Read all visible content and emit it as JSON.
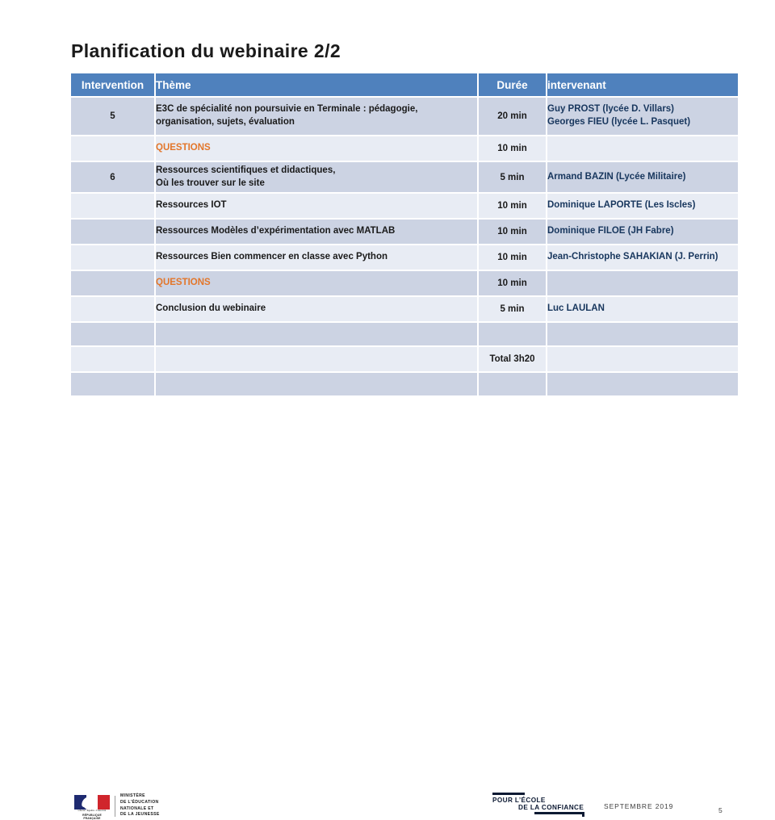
{
  "slide": {
    "title": "Planification du webinaire 2/2",
    "page_number": "5",
    "date": "SEPTEMBRE 2019"
  },
  "colors": {
    "header_blue": "#4f81bd",
    "band_dark": "#ccd3e3",
    "band_light": "#e8ecf4",
    "accent_orange": "#e3762a",
    "speaker_blue": "#17365d"
  },
  "table": {
    "headers": {
      "intervention": "Intervention",
      "theme": "Thème",
      "duree": "Durée",
      "intervenant": "intervenant"
    },
    "rows": [
      {
        "intervention": "5",
        "theme_line1": "E3C de spécialité non poursuivie en Terminale : pédagogie,",
        "theme_line2": "organisation, sujets, évaluation",
        "duree": "20 min",
        "speaker_line1": "Guy PROST (lycée D. Villars)",
        "speaker_line2": "Georges FIEU (lycée L. Pasquet)"
      },
      {
        "intervention": "",
        "theme_line1": "QUESTIONS",
        "theme_line2": "",
        "duree": "10 min",
        "speaker_line1": "",
        "speaker_line2": ""
      },
      {
        "intervention": "6",
        "theme_line1": "Ressources scientifiques et didactiques,",
        "theme_line2": "Où les trouver sur le site",
        "duree": "5 min",
        "speaker_line1": "Armand BAZIN (Lycée Militaire)",
        "speaker_line2": ""
      },
      {
        "intervention": "",
        "theme_line1": "Ressources IOT",
        "theme_line2": "",
        "duree": "10 min",
        "speaker_line1": "Dominique LAPORTE (Les Iscles)",
        "speaker_line2": ""
      },
      {
        "intervention": "",
        "theme_line1": "Ressources Modèles d’expérimentation avec MATLAB",
        "theme_line2": "",
        "duree": "10 min",
        "speaker_line1": "Dominique FILOE (JH Fabre)",
        "speaker_line2": ""
      },
      {
        "intervention": "",
        "theme_line1": "Ressources Bien commencer en classe avec Python",
        "theme_line2": "",
        "duree": "10 min",
        "speaker_line1": "Jean-Christophe SAHAKIAN (J. Perrin)",
        "speaker_line2": ""
      },
      {
        "intervention": "",
        "theme_line1": "QUESTIONS",
        "theme_line2": "",
        "duree": "10 min",
        "speaker_line1": "",
        "speaker_line2": ""
      },
      {
        "intervention": "",
        "theme_line1": "Conclusion du webinaire",
        "theme_line2": "",
        "duree": "5 min",
        "speaker_line1": "Luc LAULAN",
        "speaker_line2": ""
      },
      {
        "intervention": "",
        "theme_line1": "",
        "theme_line2": "",
        "duree": "",
        "speaker_line1": "",
        "speaker_line2": ""
      },
      {
        "intervention": "",
        "theme_line1": "",
        "theme_line2": "",
        "duree": "Total 3h20",
        "speaker_line1": "",
        "speaker_line2": ""
      },
      {
        "intervention": "",
        "theme_line1": "",
        "theme_line2": "",
        "duree": "",
        "speaker_line1": "",
        "speaker_line2": ""
      }
    ]
  },
  "footer": {
    "ministry": {
      "motto": "Liberté • Égalité • Fraternité",
      "republic": "RÉPUBLIQUE FRANÇAISE",
      "line1": "MINISTÈRE",
      "line2": "DE L’ÉDUCATION",
      "line3": "NATIONALE ET",
      "line4": "DE LA JEUNESSE"
    },
    "confiance": {
      "line1": "POUR L’ÉCOLE",
      "line2": "DE LA CONFIANCE"
    }
  }
}
